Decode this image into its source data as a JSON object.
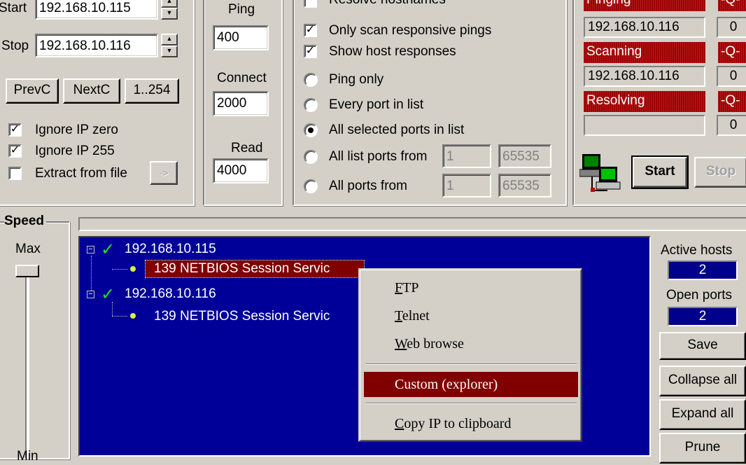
{
  "range": {
    "start_label": "Start",
    "start_value": "192.168.10.115",
    "stop_label": "Stop",
    "stop_value": "192.168.10.116",
    "prevc": "PrevC",
    "nextc": "NextC",
    "range_btn": "1..254",
    "ignore_zero": "Ignore IP zero",
    "ignore_255": "Ignore IP 255",
    "extract": "Extract from file",
    "extract_btn": "->"
  },
  "timeouts": {
    "ping_label": "Ping",
    "ping_value": "400",
    "connect_label": "Connect",
    "connect_value": "2000",
    "read_label": "Read",
    "read_value": "4000"
  },
  "options": {
    "resolve": "Resolve hostnames",
    "only_responsive": "Only scan responsive pings",
    "show_responses": "Show host responses",
    "ping_only": "Ping only",
    "every_port": "Every port in list",
    "all_selected": "All selected ports in list",
    "all_list_from": "All list ports from",
    "all_list_from_val": "1",
    "all_list_to_val": "65535",
    "all_ports_from": "All ports from",
    "all_ports_from_val": "1",
    "all_ports_to_val": "65535"
  },
  "status": {
    "pinging": "Pinging",
    "pinging_flag": "-Q-",
    "pinging_ip": "192.168.10.116",
    "pinging_count": "0",
    "scanning": "Scanning",
    "scanning_flag": "-Q-",
    "scanning_ip": "192.168.10.116",
    "scanning_count": "0",
    "resolving": "Resolving",
    "resolving_flag": "-Q-",
    "resolving_ip": "",
    "resolving_count": "0",
    "start_btn": "Start",
    "stop_btn": "Stop"
  },
  "speed": {
    "title": "Speed",
    "max": "Max",
    "min": "Min",
    "level": 1.0
  },
  "results": {
    "hosts": [
      {
        "ip": "192.168.10.115",
        "port": "139  NETBIOS Session Servic"
      },
      {
        "ip": "192.168.10.116",
        "port": "139  NETBIOS Session Servic"
      }
    ],
    "active_hosts_label": "Active hosts",
    "active_hosts": "2",
    "open_ports_label": "Open ports",
    "open_ports": "2",
    "save": "Save",
    "collapse": "Collapse all",
    "expand": "Expand all",
    "prune": "Prune"
  },
  "menu": {
    "ftp_u": "F",
    "ftp_rest": "TP",
    "telnet_u": "T",
    "telnet_rest": "elnet",
    "web_u": "W",
    "web_rest": "eb browse",
    "custom": "Custom (explorer)",
    "copy_u": "C",
    "copy_rest": "opy IP to clipboard"
  }
}
